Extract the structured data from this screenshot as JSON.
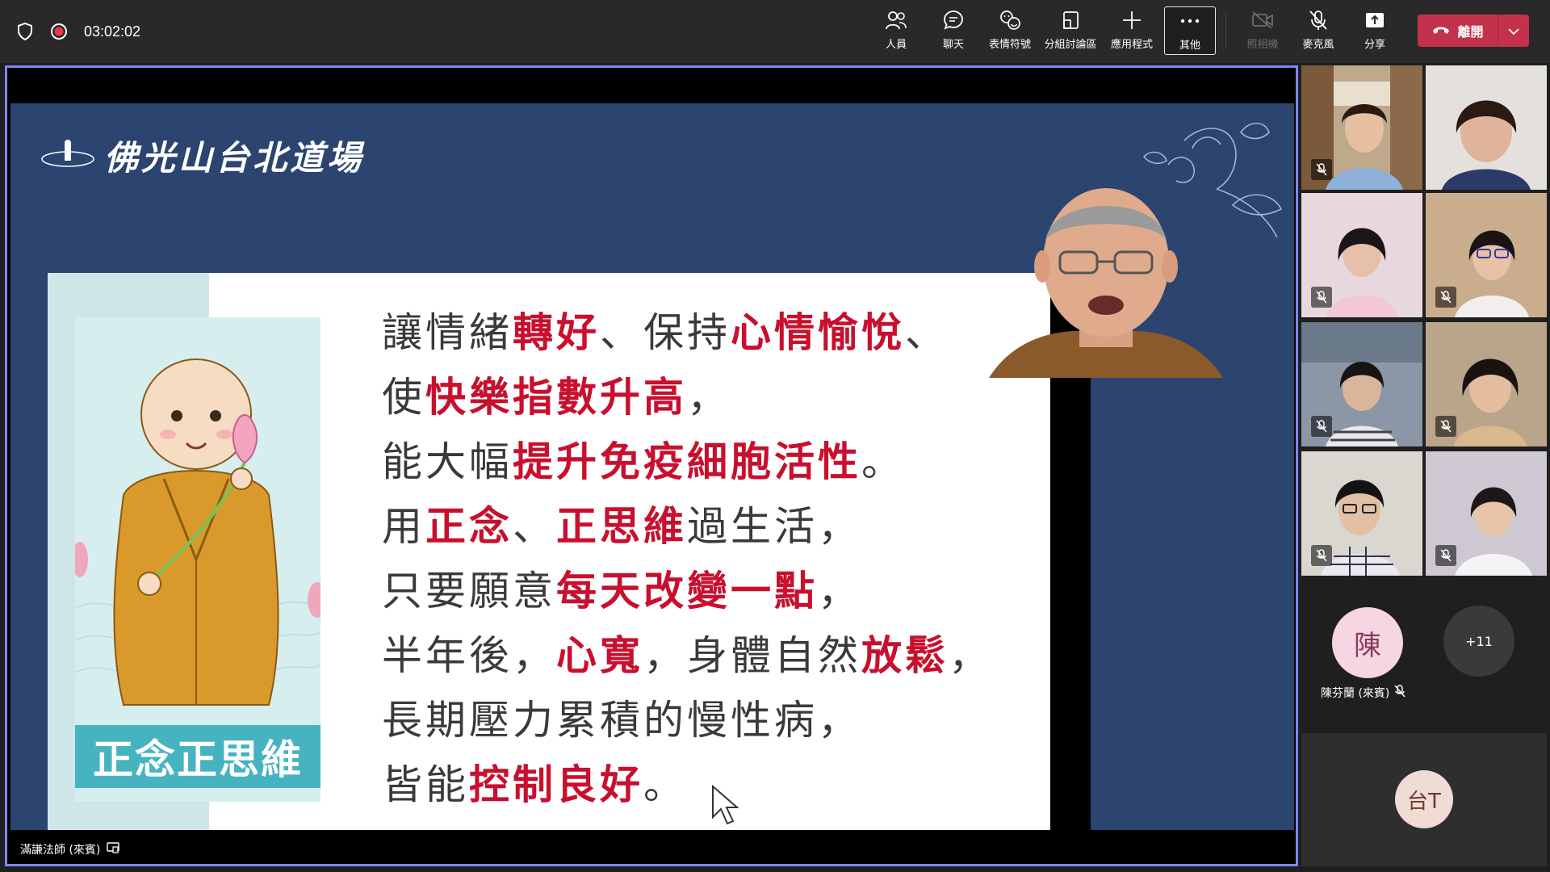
{
  "topbar": {
    "timer": "03:02:02",
    "buttons": {
      "people": "人員",
      "chat": "聊天",
      "reactions": "表情符號",
      "breakout": "分組討論區",
      "apps": "應用程式",
      "more": "其他",
      "camera": "照相機",
      "mic": "麥克風",
      "share": "分享"
    },
    "leave_label": "離開"
  },
  "slide": {
    "logo_text": "佛光山台北道場",
    "illustration_caption": "正念正思維",
    "lines": [
      [
        {
          "t": "讓情緒",
          "h": false
        },
        {
          "t": "轉好",
          "h": true
        },
        {
          "t": "、保持",
          "h": false
        },
        {
          "t": "心情愉悅",
          "h": true
        },
        {
          "t": "、",
          "h": false
        }
      ],
      [
        {
          "t": "使",
          "h": false
        },
        {
          "t": "快樂指數升高",
          "h": true
        },
        {
          "t": "，",
          "h": false
        }
      ],
      [
        {
          "t": "能大幅",
          "h": false
        },
        {
          "t": "提升免疫細胞活性",
          "h": true
        },
        {
          "t": "。",
          "h": false
        }
      ],
      [
        {
          "t": "用",
          "h": false
        },
        {
          "t": "正念",
          "h": true
        },
        {
          "t": "、",
          "h": false
        },
        {
          "t": "正思維",
          "h": true
        },
        {
          "t": "過生活，",
          "h": false
        }
      ],
      [
        {
          "t": "只要願意",
          "h": false
        },
        {
          "t": "每天改變一點",
          "h": true
        },
        {
          "t": "，",
          "h": false
        }
      ],
      [
        {
          "t": "半年後，",
          "h": false
        },
        {
          "t": "心寬",
          "h": true
        },
        {
          "t": "，身體自然",
          "h": false
        },
        {
          "t": "放鬆",
          "h": true
        },
        {
          "t": "，",
          "h": false
        }
      ],
      [
        {
          "t": "長期壓力累積的慢性病，",
          "h": false
        }
      ],
      [
        {
          "t": "皆能",
          "h": false
        },
        {
          "t": "控制良好",
          "h": true
        },
        {
          "t": "。",
          "h": false
        }
      ]
    ]
  },
  "presenter": {
    "name": "滿謙法師 (來賓)"
  },
  "roster": {
    "chen_initial": "陳",
    "chen_name": "陳芬蘭 (來賓)",
    "more_count": "+11",
    "tai_initial": "台T"
  },
  "colors": {
    "accent": "#7f85f5",
    "leave": "#c4314b",
    "highlight": "#c8102e",
    "slide_bg": "#2b4470",
    "caption_bg": "#46b3c1"
  }
}
